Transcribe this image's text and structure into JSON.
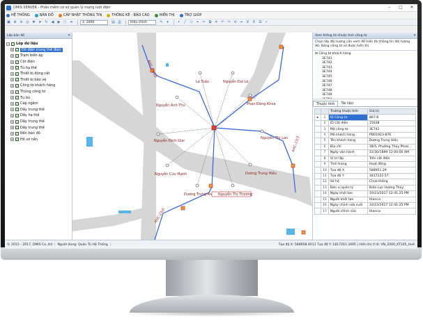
{
  "window": {
    "title": "DMIS SERVER - Phần mềm cơ sở quản lý mạng lưới điện",
    "minimize_glyph": "–",
    "maximize_glyph": "□",
    "close_glyph": "✕"
  },
  "menu": [
    {
      "label": "HỆ THỐNG",
      "color": "#2a6fc9"
    },
    {
      "label": "BẢN ĐỒ",
      "color": "#2aa0c9"
    },
    {
      "label": "CẬP NHẬT THÔNG TIN",
      "color": "#e07a1f"
    },
    {
      "label": "THỐNG KÊ - BÁO CÁO",
      "color": "#d2b416"
    },
    {
      "label": "HIỂN THỊ",
      "color": "#3a8a3a"
    },
    {
      "label": "TRỢ GIÚP",
      "color": "#2a6fc9"
    }
  ],
  "toolbar": {
    "zoom_value": "1: 2000",
    "mode_label": "Hiệu chỉnh"
  },
  "left_panel": {
    "header": "Lớp bản đồ",
    "pin_glyph": "✕",
    "root_label": "Lớp dữ liệu",
    "items": [
      {
        "label": "Đồ điện trung thế điện",
        "selected": true,
        "bold": false
      },
      {
        "label": "Trạm biến áp",
        "selected": false,
        "bold": false
      },
      {
        "label": "Cột điện",
        "selected": false,
        "bold": false
      },
      {
        "label": "Tủ hạ thế",
        "selected": false,
        "bold": false
      },
      {
        "label": "Thiết bị đóng cắt",
        "selected": false,
        "bold": false
      },
      {
        "label": "Thiết bị bảo vệ",
        "selected": false,
        "bold": false
      },
      {
        "label": "Công tơ khách hàng",
        "selected": false,
        "bold": false
      },
      {
        "label": "Thùng công tơ",
        "selected": false,
        "bold": false
      },
      {
        "label": "Tụ bù",
        "selected": false,
        "bold": false
      },
      {
        "label": "Cáp ngầm",
        "selected": false,
        "bold": false
      },
      {
        "label": "Dây trung thế",
        "selected": false,
        "bold": false
      },
      {
        "label": "Dây hạ thế",
        "selected": false,
        "bold": false
      },
      {
        "label": "Dây trung thế",
        "selected": false,
        "bold": false
      },
      {
        "label": "Dây trung thế",
        "selected": false,
        "bold": false
      },
      {
        "label": "Nền bản đồ",
        "selected": false,
        "bold": false
      },
      {
        "label": "Hồ sơ nền",
        "selected": false,
        "bold": false
      }
    ]
  },
  "map": {
    "labels": {
      "le_tuan": "Lê Tuấn",
      "nguyen_dai_le": "Nguyễn Đại Lê",
      "nguyen_anh_thu": "Nguyễn Anh Thư",
      "phan_dang_khoa": "Phan Đăng Khoa",
      "nguyen_dinh_giai": "Nguyễn Đình Giai",
      "nguyen_thi_lan": "Nguyễn Thị Lan",
      "nguyen_cuu_manh": "Nguyễn Cửu Mạnh",
      "duong_trung_hieu": "Dương Trung Hiếu",
      "duong_trung_anh": "Dương Trung Anh",
      "nguyen_thi_thuong": "Nguyễn Thị Thương",
      "line_top": "AHC-24/10",
      "line_right": "AHC-23/3",
      "line_bottom": "AHC-23/0"
    }
  },
  "right_panel": {
    "header": "Xem thông tin thuộc tính công tơ",
    "pin_glyph": "✕",
    "info_text": "Chọn lớp đối tượng cần xem để hiển thị thông tin đối tượng đó: Bảng công tơ sẽ được hiển thị.",
    "layer_root": "Công tơ khách hàng",
    "layer_items": [
      "3E741",
      "3E742",
      "3E743",
      "3E744",
      "3E745",
      "3E746",
      "3E747",
      "3E748",
      "3E749",
      "3E750"
    ],
    "tabs": [
      "Thuộc tính",
      "Tài liệu"
    ],
    "columns": [
      "Trường thuộc tính",
      "Giá trị"
    ],
    "rows": [
      {
        "idx": "1",
        "mark": "▸",
        "name": "ID Công tơ",
        "value": "867-8"
      },
      {
        "idx": "2",
        "mark": "",
        "name": "ID Cột điện",
        "value": "15638"
      },
      {
        "idx": "3",
        "mark": "",
        "name": "Mã công tơ",
        "value": "3E741"
      },
      {
        "idx": "4",
        "mark": "",
        "name": "Mã khách hàng",
        "value": "PD01923-876"
      },
      {
        "idx": "5",
        "mark": "",
        "name": "Tên khách hàng",
        "value": "Dương Trung Hiếu"
      },
      {
        "idx": "6",
        "mark": "",
        "name": "Địa chỉ",
        "value": "18/5, Phường Thủy Phươ..."
      },
      {
        "idx": "7",
        "mark": "",
        "name": "Ngày vận hành",
        "value": "12/30/1899 12:00:00 AM"
      },
      {
        "idx": "8",
        "mark": "",
        "name": "Vị trí lắp",
        "value": "Trên cột điện"
      },
      {
        "idx": "9",
        "mark": "",
        "name": "Tình trạng",
        "value": "Hoạt động"
      },
      {
        "idx": "10",
        "mark": "",
        "name": "Tọa độ X",
        "value": "588951.29"
      },
      {
        "idx": "11",
        "mark": "",
        "name": "Tọa độ Y",
        "value": "1817222.57"
      },
      {
        "idx": "12",
        "mark": "",
        "name": "Số hộ",
        "value": "Chưa thống"
      },
      {
        "idx": "13",
        "mark": "",
        "name": "Đơn vị quản lý",
        "value": "Điện Lực Hương Thủy"
      },
      {
        "idx": "14",
        "mark": "",
        "name": "Ngày khởi tạo",
        "value": "10/23/2017 12:41:25 PM"
      },
      {
        "idx": "15",
        "mark": "",
        "name": "Người khởi tạo",
        "value": "thanna"
      },
      {
        "idx": "16",
        "mark": "",
        "name": "Ngày chỉnh sửa cuối",
        "value": "10/23/2017 12:41:25 PM"
      },
      {
        "idx": "17",
        "mark": "",
        "name": "Người chỉnh sửa",
        "value": "thanna"
      }
    ]
  },
  "status": {
    "copyright": "© 2015 - 2017, DMIS Co.,ltd",
    "user": "Người dùng: Quản Trị Hệ Thống",
    "coords": "Tọa độ X: 588958.4011 Tọa độ Y: 1817261.3495 | Hiển thị tỉ lệ: VN_2000_KT105_Huế"
  }
}
